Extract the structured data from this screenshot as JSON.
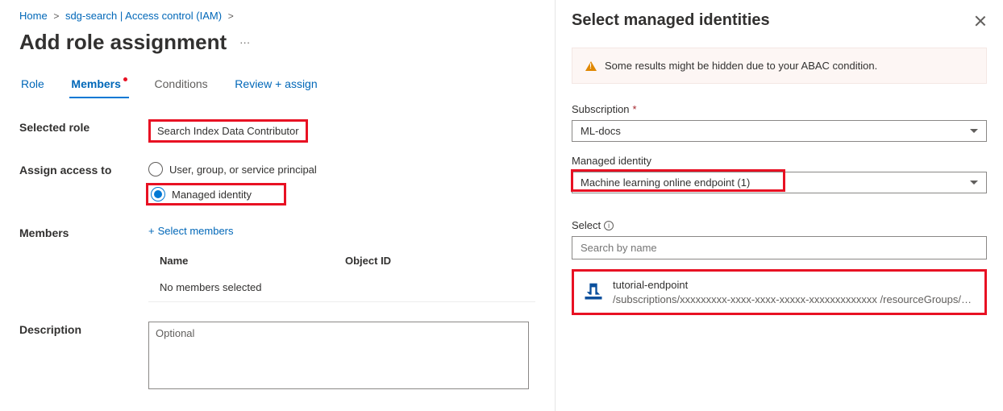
{
  "breadcrumb": {
    "home": "Home",
    "mid": "sdg-search | Access control (IAM)"
  },
  "page_title": "Add role assignment",
  "tabs": {
    "role": "Role",
    "members": "Members",
    "conditions": "Conditions",
    "review": "Review + assign"
  },
  "form": {
    "selected_role_label": "Selected role",
    "selected_role_value": "Search Index Data Contributor",
    "assign_label": "Assign access to",
    "assign_option_user": "User, group, or service principal",
    "assign_option_mi": "Managed identity",
    "members_label": "Members",
    "select_members_link": "Select members",
    "table_col_name": "Name",
    "table_col_obj": "Object ID",
    "no_members": "No members selected",
    "description_label": "Description",
    "description_placeholder": "Optional"
  },
  "panel": {
    "title": "Select managed identities",
    "warning": "Some results might be hidden due to your ABAC condition.",
    "subscription_label": "Subscription",
    "subscription_value": "ML-docs",
    "mi_label": "Managed identity",
    "mi_value": "Machine learning online endpoint (1)",
    "select_label": "Select",
    "search_placeholder": "Search by name",
    "result_name": "tutorial-endpoint",
    "result_path": "/subscriptions/xxxxxxxxx-xxxx-xxxx-xxxxx-xxxxxxxxxxxxx /resourceGroups/sdg-ai-..."
  }
}
